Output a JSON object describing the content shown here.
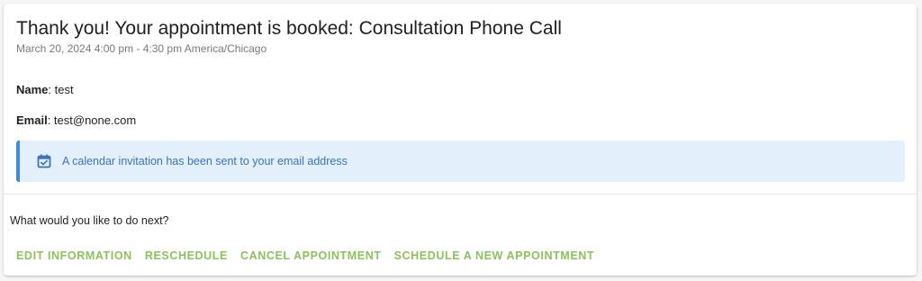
{
  "header": {
    "title": "Thank you! Your appointment is booked: Consultation Phone Call",
    "datetime": "March 20, 2024 4:00 pm - 4:30 pm America/Chicago"
  },
  "details": {
    "name_label": "Name",
    "name_value": "test",
    "email_label": "Email",
    "email_value": "test@none.com"
  },
  "alert": {
    "icon": "calendar-check-icon",
    "text": "A calendar invitation has been sent to your email address",
    "accent_color": "#3a8fdc",
    "background_color": "#e3f0fb"
  },
  "next": {
    "prompt": "What would you like to do next?",
    "actions": [
      {
        "label": "EDIT INFORMATION"
      },
      {
        "label": "RESCHEDULE"
      },
      {
        "label": "CANCEL APPOINTMENT"
      },
      {
        "label": "SCHEDULE A NEW APPOINTMENT"
      }
    ],
    "action_color": "#8dc25b"
  }
}
